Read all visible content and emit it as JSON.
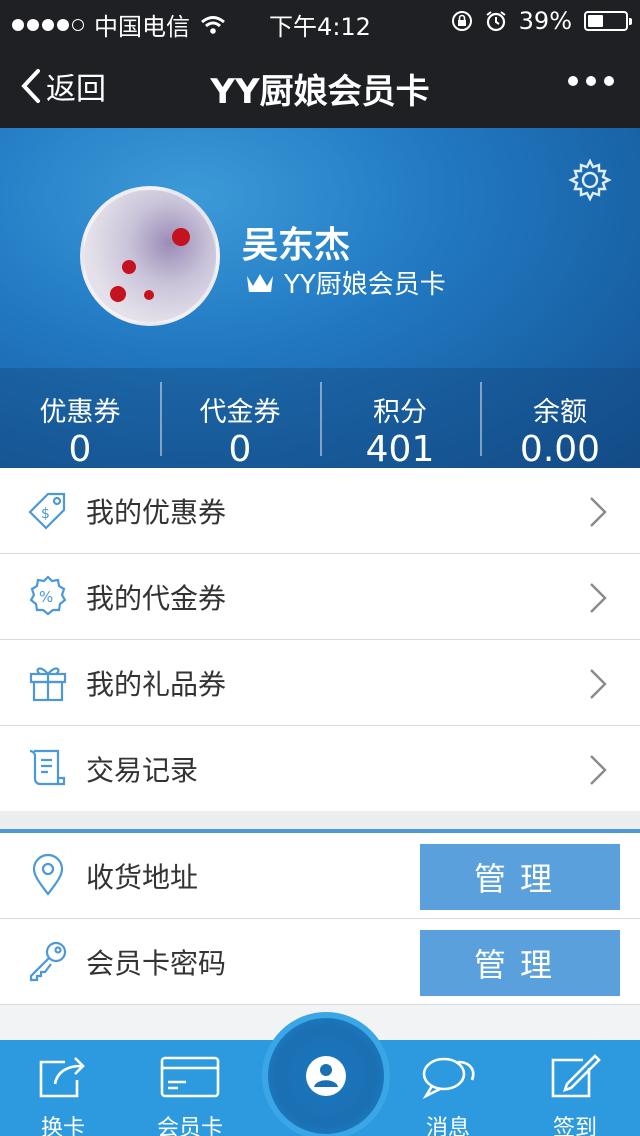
{
  "status_bar": {
    "carrier": "中国电信",
    "time": "下午4:12",
    "battery": "39%"
  },
  "nav": {
    "back_label": "返回",
    "title": "YY厨娘会员卡"
  },
  "profile": {
    "name": "吴东杰",
    "card_name": "YY厨娘会员卡"
  },
  "stats": [
    {
      "label": "优惠券",
      "value": "0"
    },
    {
      "label": "代金券",
      "value": "0"
    },
    {
      "label": "积分",
      "value": "401"
    },
    {
      "label": "余额",
      "value": "0.00"
    }
  ],
  "menu": [
    {
      "label": "我的优惠券",
      "icon": "coupon-tag-icon"
    },
    {
      "label": "我的代金券",
      "icon": "voucher-percent-icon"
    },
    {
      "label": "我的礼品券",
      "icon": "gift-icon"
    },
    {
      "label": "交易记录",
      "icon": "scroll-record-icon"
    }
  ],
  "settings": [
    {
      "label": "收货地址",
      "icon": "location-pin-icon",
      "button": "管理"
    },
    {
      "label": "会员卡密码",
      "icon": "key-icon",
      "button": "管理"
    }
  ],
  "tabs": [
    {
      "label": "换卡",
      "icon": "share-card-icon"
    },
    {
      "label": "会员卡",
      "icon": "card-icon"
    },
    {
      "label": "消息",
      "icon": "chat-bubbles-icon"
    },
    {
      "label": "签到",
      "icon": "edit-signin-icon"
    }
  ],
  "colors": {
    "accent": "#2d9ae0",
    "nav_bg": "#1f2024",
    "button": "#5aa0dc"
  }
}
